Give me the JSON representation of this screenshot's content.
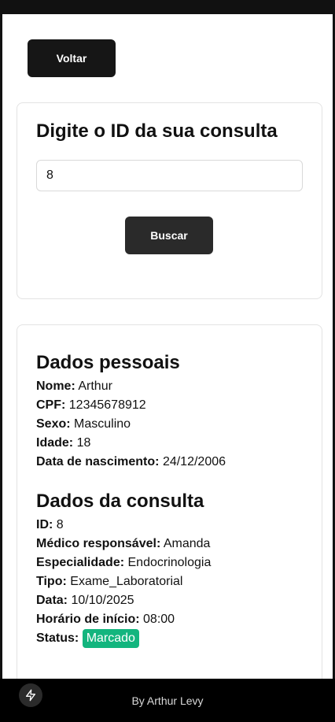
{
  "nav": {
    "back_label": "Voltar"
  },
  "search": {
    "title": "Digite o ID da sua consulta",
    "input_value": "8",
    "button_label": "Buscar"
  },
  "personal": {
    "title": "Dados pessoais",
    "fields": [
      {
        "label": "Nome:",
        "value": "Arthur"
      },
      {
        "label": "CPF:",
        "value": "12345678912"
      },
      {
        "label": "Sexo:",
        "value": "Masculino"
      },
      {
        "label": "Idade:",
        "value": "18"
      },
      {
        "label": "Data de nascimento:",
        "value": "24/12/2006"
      }
    ]
  },
  "consult": {
    "title": "Dados da consulta",
    "fields": [
      {
        "label": "ID:",
        "value": "8"
      },
      {
        "label": "Médico responsável:",
        "value": "Amanda"
      },
      {
        "label": "Especialidade:",
        "value": "Endocrinologia"
      },
      {
        "label": "Tipo:",
        "value": "Exame_Laboratorial"
      },
      {
        "label": "Data:",
        "value": "10/10/2025"
      },
      {
        "label": "Horário de início:",
        "value": "08:00"
      }
    ],
    "status_label": "Status:",
    "status_value": "Marcado",
    "status_color": "#13b57e"
  },
  "footer": {
    "text": "By Arthur Levy",
    "icon": "bolt-icon"
  }
}
